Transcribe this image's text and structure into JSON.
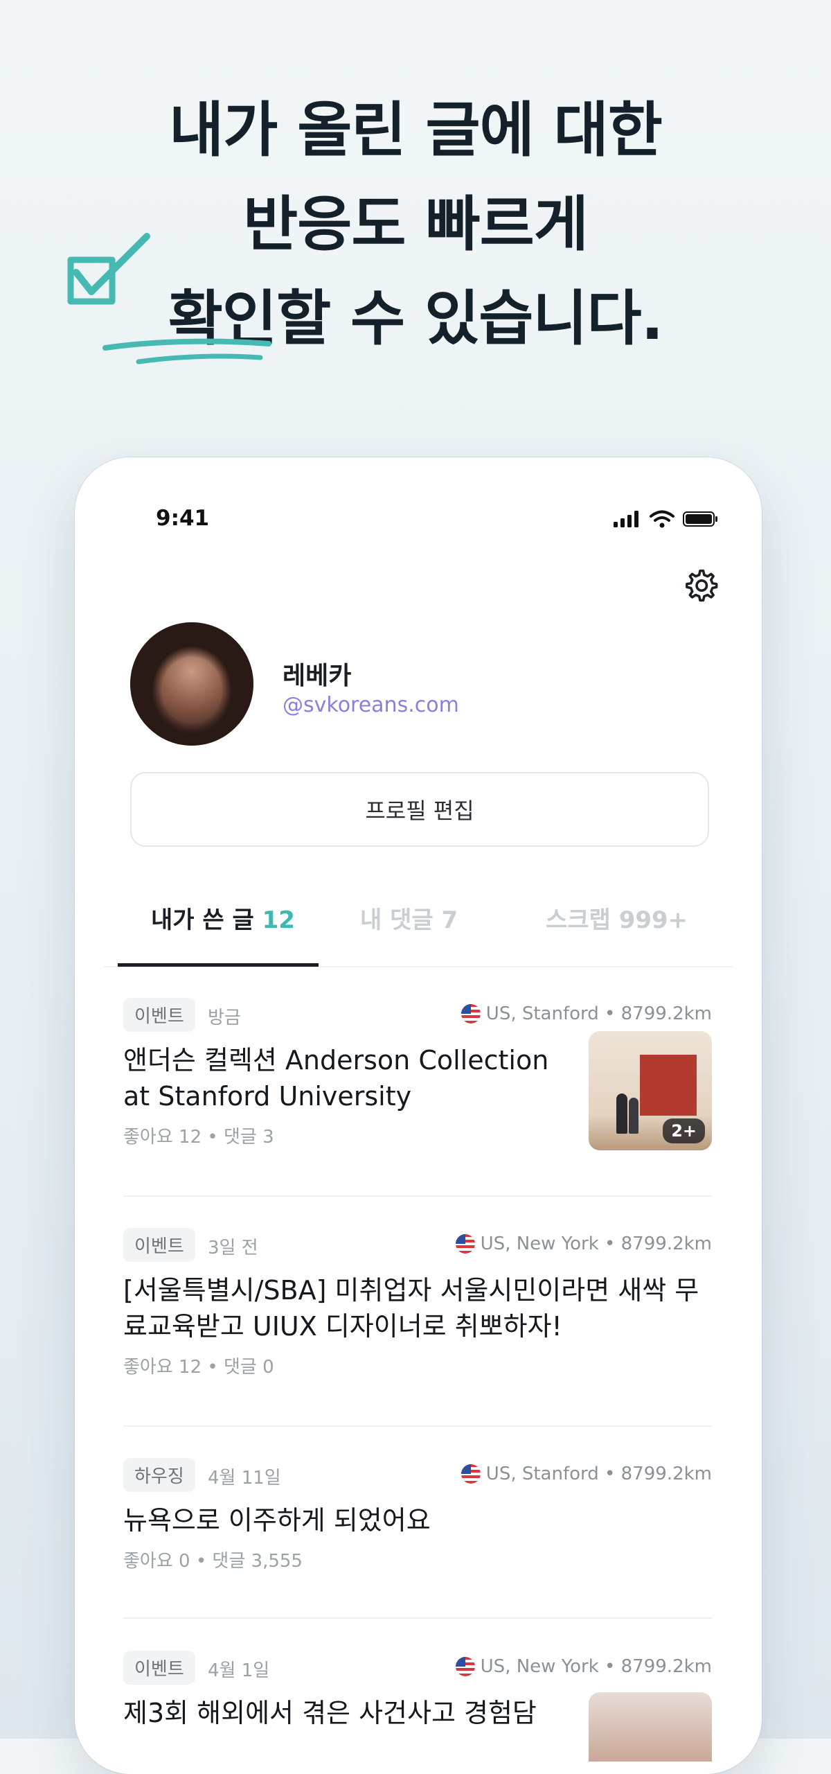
{
  "headline": {
    "line1": "내가 올린 글에 대한",
    "line2": "반응도 빠르게",
    "line3": "확인할 수 있습니다."
  },
  "colors": {
    "accent": "#3fb8b0",
    "email": "#8b7ee0",
    "headline": "#14202a"
  },
  "status_bar": {
    "time": "9:41",
    "icons": [
      "signal-icon",
      "wifi-icon",
      "battery-icon"
    ]
  },
  "profile": {
    "name": "레베카",
    "email": "@svkoreans.com",
    "edit_label": "프로필 편집",
    "settings_icon": "gear-icon"
  },
  "tabs": [
    {
      "label": "내가 쓴 글",
      "count": "12"
    },
    {
      "label": "내 댓글",
      "count": "7"
    },
    {
      "label": "스크랩",
      "count": "999+"
    }
  ],
  "posts": [
    {
      "category": "이벤트",
      "time": "방금",
      "location": "US, Stanford • 8799.2km",
      "title": "앤더슨 컬렉션 Anderson Collection at Stanford University",
      "stats": "좋아요 12 • 댓글 3",
      "image_count": "2+"
    },
    {
      "category": "이벤트",
      "time": "3일 전",
      "location": "US, New York • 8799.2km",
      "title": "[서울특별시/SBA] 미취업자 서울시민이라면 새싹 무료교육받고 UIUX 디자이너로 취뽀하자!",
      "stats": "좋아요 12 • 댓글 0"
    },
    {
      "category": "하우징",
      "time": "4월 11일",
      "location": "US, Stanford • 8799.2km",
      "title": "뉴욕으로 이주하게 되었어요",
      "stats": "좋아요 0 • 댓글 3,555"
    },
    {
      "category": "이벤트",
      "time": "4월 1일",
      "location": "US, New York • 8799.2km",
      "title": "제3회 해외에서 겪은 사건사고 경험담"
    }
  ]
}
